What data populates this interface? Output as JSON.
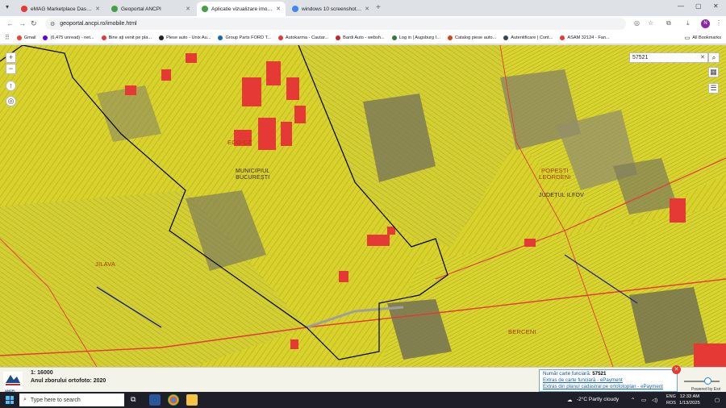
{
  "browser": {
    "tabs": [
      {
        "title": "eMAG Marketplace Dashboard",
        "favicon_color": "#e53935",
        "active": false
      },
      {
        "title": "Geoportal ANCPI",
        "favicon_color": "#43a047",
        "active": false
      },
      {
        "title": "Aplicatie vizualizare imobile",
        "favicon_color": "#43a047",
        "active": true
      },
      {
        "title": "windows 10 screenshot - Căut",
        "favicon_color": "#4285f4",
        "active": false
      }
    ],
    "url": "geoportal.ancpi.ro/imobile.html",
    "profile_initial": "N",
    "bookmarks": [
      {
        "label": "Gmail",
        "color": "#ea4335"
      },
      {
        "label": "(6,475 unread) - net...",
        "color": "#6001d2"
      },
      {
        "label": "Bine ați venit pe pla...",
        "color": "#e53935"
      },
      {
        "label": "Piese auto - Unix Au...",
        "color": "#222222"
      },
      {
        "label": "Group Parts FORD T...",
        "color": "#1565c0"
      },
      {
        "label": "Autokarma - Cautar...",
        "color": "#e53935"
      },
      {
        "label": "Bardi Auto - websh...",
        "color": "#c62828"
      },
      {
        "label": "Log in | Augsburg I...",
        "color": "#2e7d32"
      },
      {
        "label": "Catalog piese auto...",
        "color": "#d84315"
      },
      {
        "label": "Autentificare | Cont...",
        "color": "#37474f"
      },
      {
        "label": "ASAM 32124 - Fan...",
        "color": "#e53935"
      }
    ],
    "all_bookmarks_label": "All Bookmarks"
  },
  "map": {
    "search_value": "57521",
    "labels": {
      "cf_zone": "ECO-CZ",
      "municipiu": "MUNICIPIUL\nBUCUREȘTI",
      "judet": "JUDEȚUL ILFOV",
      "popesti": "POPEȘTI\nLEORDENI",
      "jilava": "JILAVA",
      "berceni": "BERCENI"
    },
    "colors": {
      "parcel": "#d8d22a",
      "parcel_dark": "#7d7a57",
      "built": "#e53935",
      "boundary": "#000000",
      "road": "#e53935"
    }
  },
  "status": {
    "scale": "1: 16000",
    "orthophoto_year": "Anul zborului ortofoto: 2020",
    "logo_caption": "ANCPI",
    "popup": {
      "number_label": "Număr carte funciară:",
      "number_value": "57521",
      "link_extract_cf": "Extras de carte funciară - ePayment",
      "link_extract_plan": "Extras din planul cadastral pe ortofotoplan - ePayment"
    },
    "slider_fraction": 0.72,
    "powered_by": "Powered by Esri"
  },
  "taskbar": {
    "search_placeholder": "Type here to search",
    "weather": "-2°C  Partly cloudy",
    "lang": "ENG\nROS",
    "time": "12:33 AM",
    "date": "1/13/2025"
  }
}
